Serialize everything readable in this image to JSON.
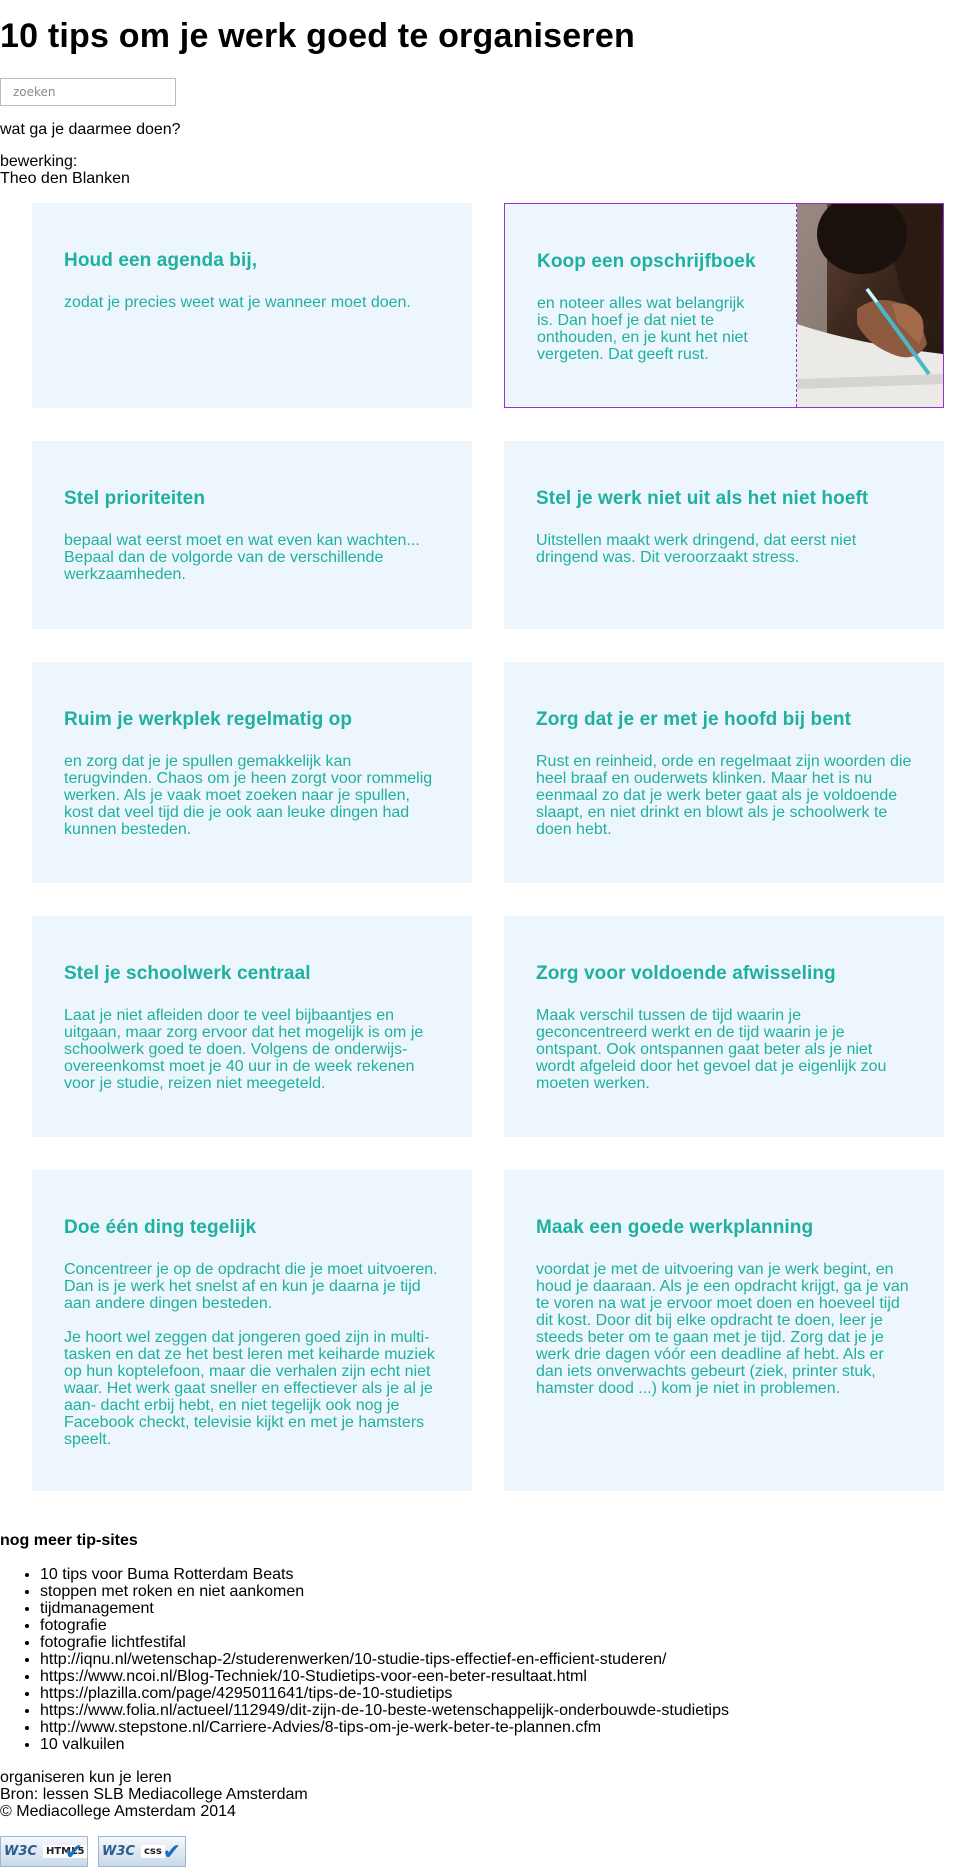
{
  "page": {
    "title": "10 tips om je werk goed te organiseren",
    "search_placeholder": "zoeken",
    "subtitle": "wat ga je daarmee doen?",
    "credits_label": "bewerking:",
    "credits_name": "Theo den Blanken"
  },
  "tips": [
    {
      "heading": "Houd een agenda bij,",
      "paragraphs": [
        "zodat je precies weet wat je wanneer moet doen."
      ]
    },
    {
      "heading": "Koop een opschrijfboek",
      "paragraphs": [
        "en noteer alles wat belangrijk is. Dan hoef je dat niet te onthouden, en je kunt het niet vergeten. Dat geeft rust."
      ]
    },
    {
      "heading": "Stel prioriteiten",
      "paragraphs": [
        "bepaal wat eerst moet en wat even kan wachten... Bepaal dan de volgorde van de verschillende werkzaamheden."
      ]
    },
    {
      "heading": "Stel je werk niet uit als het niet hoeft",
      "paragraphs": [
        "Uitstellen maakt werk dringend, dat eerst niet dringend was. Dit veroorzaakt stress."
      ]
    },
    {
      "heading": "Ruim je werkplek regelmatig op",
      "paragraphs": [
        "en zorg dat je je spullen gemakkelijk kan terugvinden. Chaos om je heen zorgt voor rommelig werken. Als je vaak moet zoeken naar je spullen, kost dat veel tijd die je ook aan leuke dingen had kunnen besteden."
      ]
    },
    {
      "heading": "Zorg dat je er met je hoofd bij bent",
      "paragraphs": [
        "Rust en reinheid, orde en regelmaat zijn woorden die heel braaf en ouderwets klinken. Maar het is nu eenmaal zo dat je werk beter gaat als je voldoende slaapt, en niet drinkt en blowt als je schoolwerk te doen hebt."
      ]
    },
    {
      "heading": "Stel je schoolwerk centraal",
      "paragraphs": [
        "Laat je niet afleiden door te veel bijbaantjes en uitgaan, maar zorg ervoor dat het mogelijk is om je schoolwerk goed te doen. Volgens de onderwijs-overeenkomst moet je 40 uur in de week rekenen voor je studie, reizen niet meegeteld."
      ]
    },
    {
      "heading": "Zorg voor voldoende afwisseling",
      "paragraphs": [
        "Maak verschil tussen de tijd waarin je geconcentreerd werkt en de tijd waarin je je ontspant. Ook ontspannen gaat beter als je niet wordt afgeleid door het gevoel dat je eigenlijk zou moeten werken."
      ]
    },
    {
      "heading": "Doe één ding tegelijk",
      "paragraphs": [
        "Concentreer je op de opdracht die je moet uitvoeren. Dan is je werk het snelst af en kun je daarna je tijd aan andere dingen besteden.",
        "Je hoort wel zeggen dat jongeren goed zijn in multi-tasken en dat ze het best leren met keiharde muziek op hun koptelefoon, maar die verhalen zijn echt niet waar. Het werk gaat sneller en effectiever als je al je aan- dacht erbij hebt, en niet tegelijk ook nog je Facebook checkt, televisie kijkt en met je hamsters speelt."
      ]
    },
    {
      "heading": "Maak een goede werkplanning",
      "paragraphs": [
        "voordat je met de uitvoering van je werk begint, en houd je daaraan. Als je een opdracht krijgt, ga je van te voren na wat je ervoor moet doen en hoeveel tijd dit kost. Door dit bij elke opdracht te doen, leer je steeds beter om te gaan met je tijd. Zorg dat je je werk drie dagen vóór een deadline af hebt. Als er dan iets onverwachts gebeurt (ziek, printer stuk, hamster dood ...) kom je niet in problemen."
      ]
    }
  ],
  "links": {
    "heading": "nog meer tip-sites",
    "items": [
      "10 tips voor Buma Rotterdam Beats",
      "stoppen met roken en niet aankomen",
      "tijdmanagement",
      "fotografie",
      "fotografie lichtfestifal",
      "http://iqnu.nl/wetenschap-2/studerenwerken/10-studie-tips-effectief-en-efficient-studeren/",
      "https://www.ncoi.nl/Blog-Techniek/10-Studietips-voor-een-beter-resultaat.html",
      "https://plazilla.com/page/4295011641/tips-de-10-studietips",
      "https://www.folia.nl/actueel/112949/dit-zijn-de-10-beste-wetenschappelijk-onderbouwde-studietips",
      "http://www.stepstone.nl/Carriere-Advies/8-tips-om-je-werk-beter-te-plannen.cfm",
      "10 valkuilen"
    ]
  },
  "footer": {
    "line1": "organiseren kun je leren",
    "line2": "Bron: lessen SLB Mediacollege Amsterdam",
    "line3": "© Mediacollege Amsterdam 2014"
  },
  "badges": [
    {
      "w3": "W3C",
      "label": "HTML5",
      "check": "✔"
    },
    {
      "w3": "W3C",
      "label": "css",
      "check": "✔"
    }
  ],
  "colors": {
    "card_bg": "#eef6fd",
    "card_text": "#1fb0a0",
    "highlight_border": "#9b30d0"
  }
}
